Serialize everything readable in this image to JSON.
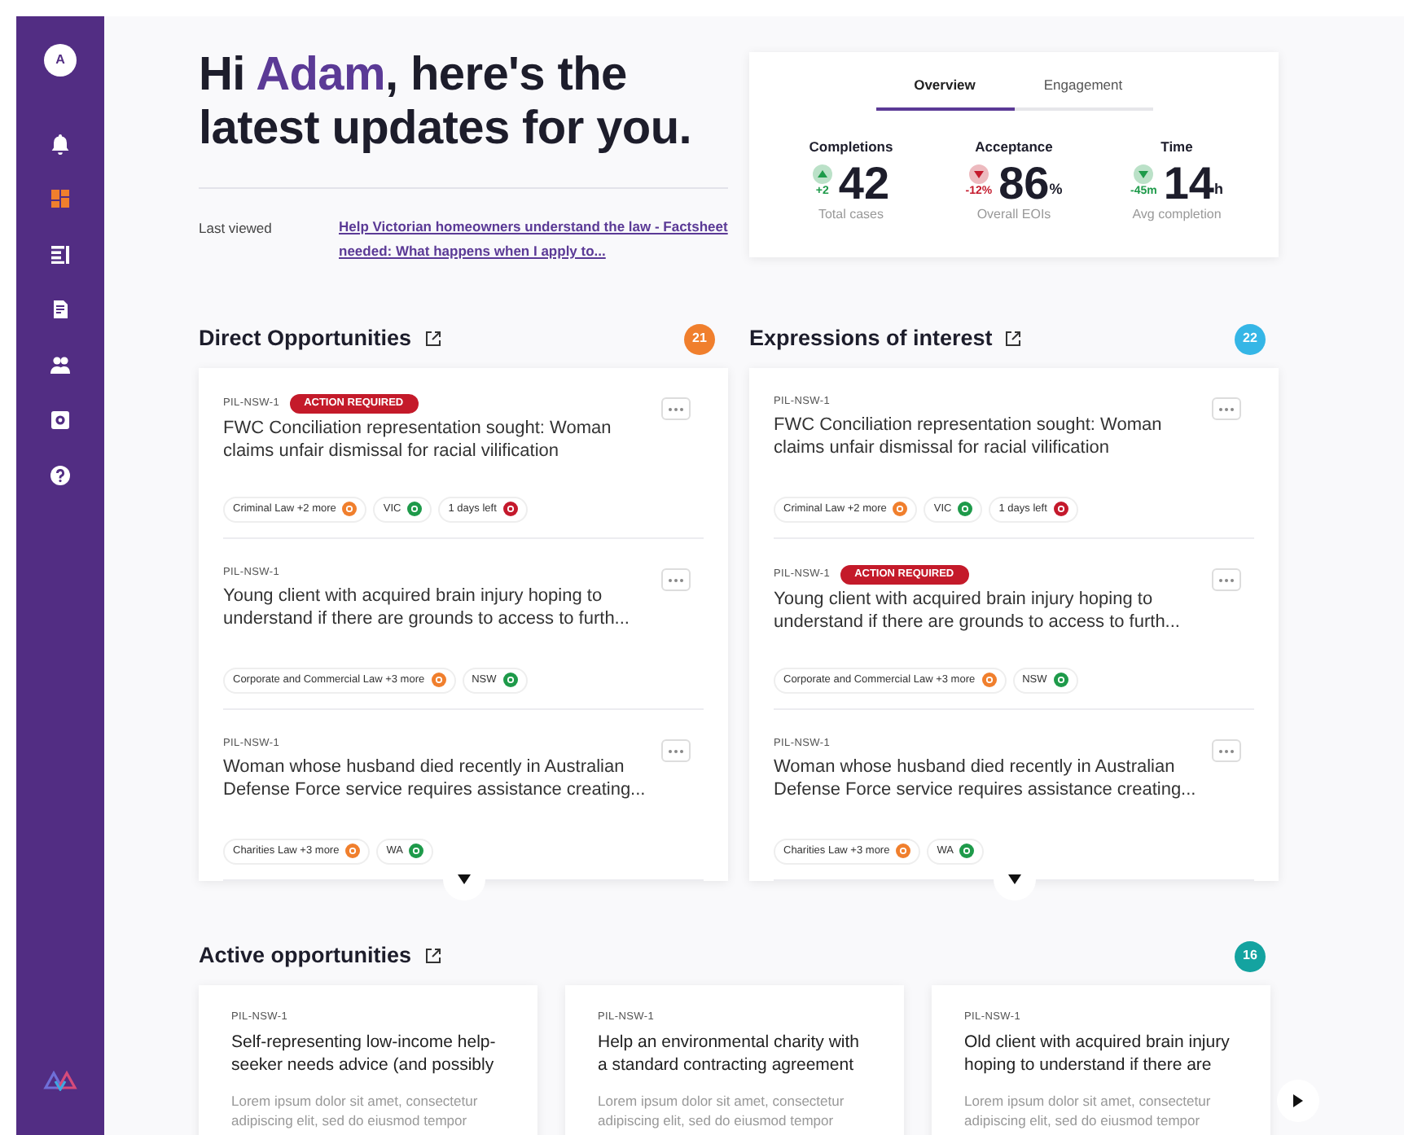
{
  "sidebar": {
    "avatar": "A",
    "items": [
      {
        "selected": false
      },
      {
        "selected": true
      },
      {
        "selected": false
      },
      {
        "selected": false
      },
      {
        "selected": false
      },
      {
        "selected": false
      },
      {
        "selected": false
      }
    ]
  },
  "greeting": {
    "prefix": "Hi ",
    "name": "Adam",
    "rest": ", here's the latest updates for you."
  },
  "last_viewed": {
    "label": "Last viewed",
    "link": "Help Victorian homeowners understand the law - Factsheet needed: What happens when I apply to..."
  },
  "stats": {
    "tabs": [
      {
        "label": "Overview",
        "selected": true
      },
      {
        "label": "Engagement",
        "selected": false
      }
    ],
    "items": [
      {
        "label": "Completions",
        "kind": "up",
        "color": "#1e9a4a",
        "delta": "+2",
        "value": "42",
        "caption": "Total cases"
      },
      {
        "label": "Acceptance",
        "kind": "down",
        "color": "#c4192c",
        "delta": "-12%",
        "value": "86",
        "unit": "%",
        "caption": "Overall EOIs"
      },
      {
        "label": "Time",
        "kind": "down",
        "color": "#1e9a4a",
        "delta": "-45m",
        "value": "14",
        "unit": "h",
        "caption": "Avg completion"
      }
    ]
  },
  "sections": [
    {
      "title": "Direct Opportunities",
      "count": "21",
      "color": "#f07f2d",
      "items": [
        {
          "code": "PIL-NSW-1",
          "flag": "ACTION REQUIRED",
          "title": "FWC Conciliation representation sought: Woman claims unfair dismissal for racial vilification",
          "tags": [
            {
              "label": "Criminal Law +2 more",
              "color": "#f07f2d"
            },
            {
              "label": "VIC",
              "color": "#1e9a4a"
            },
            {
              "label": "1 days left",
              "color": "#c4192c"
            }
          ]
        },
        {
          "code": "PIL-NSW-1",
          "title": "Young client with acquired brain injury hoping to understand if there are grounds to access to furth...",
          "tags": [
            {
              "label": "Corporate and Commercial Law +3 more",
              "color": "#f07f2d"
            },
            {
              "label": "NSW",
              "color": "#1e9a4a"
            }
          ]
        },
        {
          "code": "PIL-NSW-1",
          "title": "Woman whose husband died recently in Australian Defense Force service requires assistance creating...",
          "tags": [
            {
              "label": "Charities Law +3 more",
              "color": "#f07f2d"
            },
            {
              "label": "WA",
              "color": "#1e9a4a"
            }
          ]
        }
      ]
    },
    {
      "title": "Expressions of interest",
      "count": "22",
      "color": "#35b6e6",
      "items": [
        {
          "code": "PIL-NSW-1",
          "title": "FWC Conciliation representation sought: Woman claims unfair dismissal for racial vilification",
          "tags": [
            {
              "label": "Criminal Law +2 more",
              "color": "#f07f2d"
            },
            {
              "label": "VIC",
              "color": "#1e9a4a"
            },
            {
              "label": "1 days left",
              "color": "#c4192c"
            }
          ]
        },
        {
          "code": "PIL-NSW-1",
          "flag": "ACTION REQUIRED",
          "title": "Young client with acquired brain injury hoping to understand if there are grounds to access to furth...",
          "tags": [
            {
              "label": "Corporate and Commercial Law +3 more",
              "color": "#f07f2d"
            },
            {
              "label": "NSW",
              "color": "#1e9a4a"
            }
          ]
        },
        {
          "code": "PIL-NSW-1",
          "title": "Woman whose husband died recently in Australian Defense Force service requires assistance creating...",
          "tags": [
            {
              "label": "Charities Law +3 more",
              "color": "#f07f2d"
            },
            {
              "label": "WA",
              "color": "#1e9a4a"
            }
          ]
        }
      ]
    }
  ],
  "active": {
    "title": "Active opportunities",
    "count": "16",
    "color": "#14a3a0",
    "items": [
      {
        "code": "PIL-NSW-1",
        "title": "Self-representing low-income help-seeker needs advice (and possibly",
        "text": "Lorem ipsum dolor sit amet, consectetur adipiscing elit, sed do eiusmod tempor"
      },
      {
        "code": "PIL-NSW-1",
        "title": "Help an environmental charity with a standard contracting agreement",
        "text": "Lorem ipsum dolor sit amet, consectetur adipiscing elit, sed do eiusmod tempor"
      },
      {
        "code": "PIL-NSW-1",
        "title": "Old client with acquired brain injury hoping to understand if there are",
        "text": "Lorem ipsum dolor sit amet, consectetur adipiscing elit, sed do eiusmod tempor"
      }
    ]
  }
}
